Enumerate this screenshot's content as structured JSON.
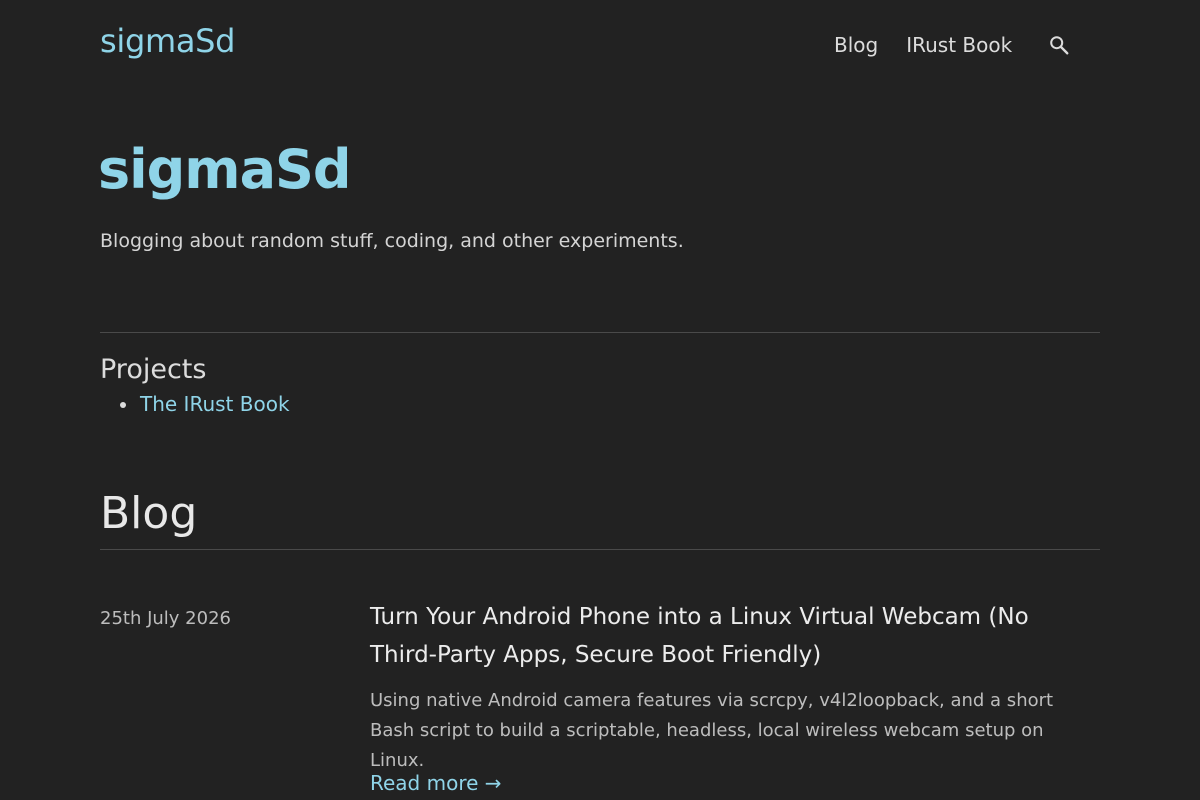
{
  "header": {
    "site_title": "sigmaSd",
    "nav": [
      {
        "label": "Blog"
      },
      {
        "label": "IRust Book"
      }
    ],
    "search_icon": "search-icon"
  },
  "hero": {
    "title": "sigmaSd",
    "description": "Blogging about random stuff, coding, and other experiments."
  },
  "projects": {
    "heading": "Projects",
    "items": [
      {
        "label": "The IRust Book"
      }
    ]
  },
  "blog": {
    "heading": "Blog",
    "posts": [
      {
        "date": "25th July 2026",
        "title": "Turn Your Android Phone into a Linux Virtual Webcam (No Third-Party Apps, Secure Boot Friendly)",
        "summary": "Using native Android camera features via scrcpy, v4l2loopback, and a short Bash script to build a scriptable, headless, local wireless webcam setup on Linux.",
        "read_more": "Read more →"
      }
    ]
  },
  "colors": {
    "background": "#222222",
    "accent": "#8fd4e8",
    "text": "#dcdcdc"
  }
}
